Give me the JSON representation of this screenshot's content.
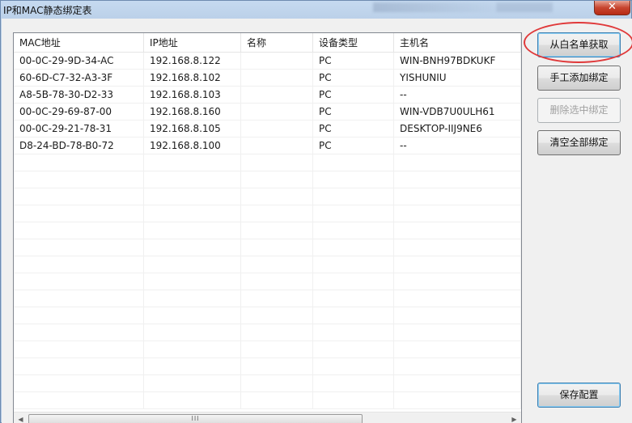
{
  "window": {
    "title": "IP和MAC静态绑定表",
    "close_label": "✕"
  },
  "table": {
    "columns": [
      "MAC地址",
      "IP地址",
      "名称",
      "设备类型",
      "主机名"
    ],
    "rows": [
      [
        "00-0C-29-9D-34-AC",
        "192.168.8.122",
        "",
        "PC",
        "WIN-BNH97BDKUKF"
      ],
      [
        "60-6D-C7-32-A3-3F",
        "192.168.8.102",
        "",
        "PC",
        "YISHUNIU"
      ],
      [
        "A8-5B-78-30-D2-33",
        "192.168.8.103",
        "",
        "PC",
        "--"
      ],
      [
        "00-0C-29-69-87-00",
        "192.168.8.160",
        "",
        "PC",
        "WIN-VDB7U0ULH61"
      ],
      [
        "00-0C-29-21-78-31",
        "192.168.8.105",
        "",
        "PC",
        "DESKTOP-IIJ9NE6"
      ],
      [
        "D8-24-BD-78-B0-72",
        "192.168.8.100",
        "",
        "PC",
        "--"
      ]
    ]
  },
  "scrollbar": {
    "left_arrow": "◀",
    "right_arrow": "▶",
    "thumb_grip": "III"
  },
  "buttons": {
    "import_whitelist": "从白名单获取",
    "manual_add": "手工添加绑定",
    "delete_selected": "删除选中绑定",
    "clear_all": "清空全部绑定",
    "save_config": "保存配置"
  },
  "colors": {
    "highlight_ellipse": "#e0393a",
    "window_frame": "#b7cde6"
  }
}
